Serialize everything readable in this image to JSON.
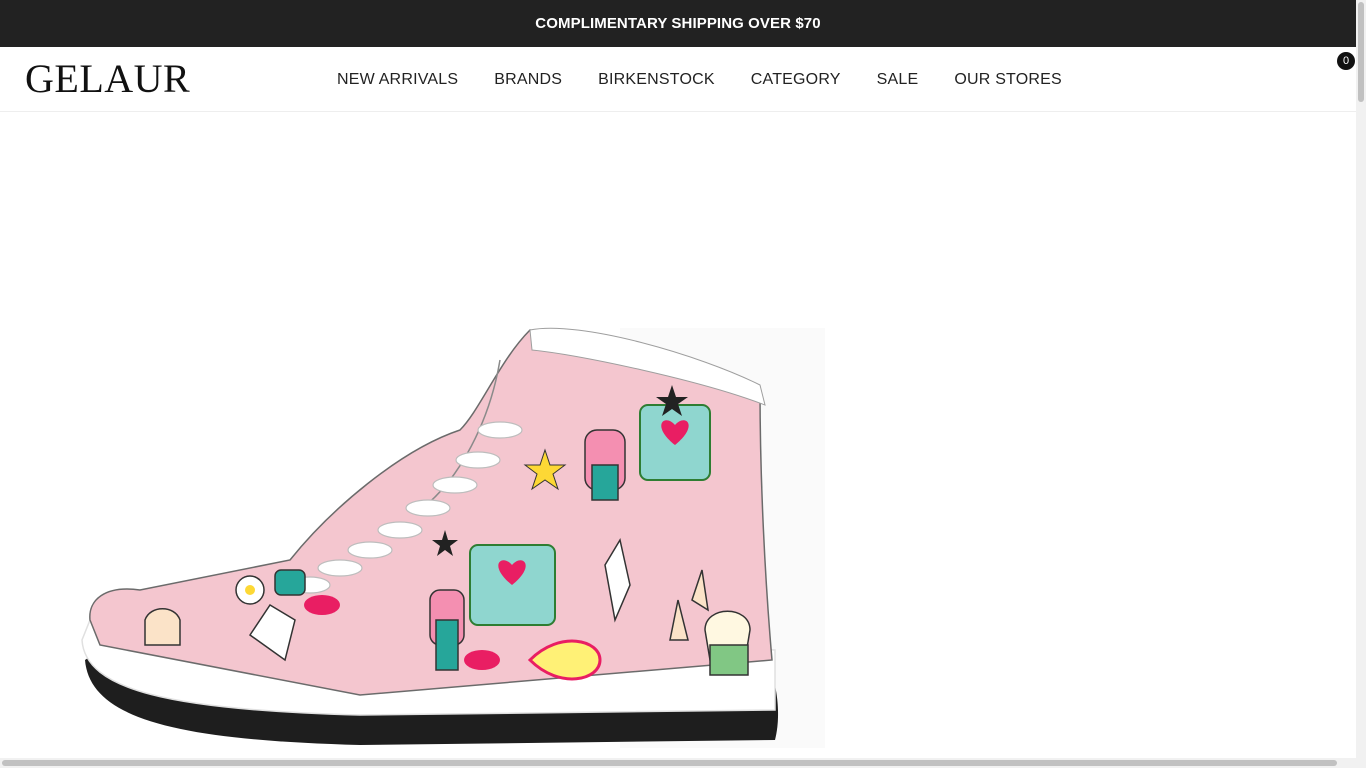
{
  "announcement": {
    "text": "COMPLIMENTARY SHIPPING OVER $70"
  },
  "header": {
    "logo": "GELAUR",
    "nav": [
      {
        "label": "NEW ARRIVALS"
      },
      {
        "label": "BRANDS"
      },
      {
        "label": "BIRKENSTOCK"
      },
      {
        "label": "CATEGORY"
      },
      {
        "label": "SALE"
      },
      {
        "label": "OUR STORES"
      }
    ],
    "cart_count": "0"
  },
  "product": {
    "image_subject": "pink high-top sneaker with sticker-style print"
  },
  "colors": {
    "announcement_bg": "#222222",
    "accent_pink": "#f4c6cf",
    "sole": "#1e1e1e"
  }
}
